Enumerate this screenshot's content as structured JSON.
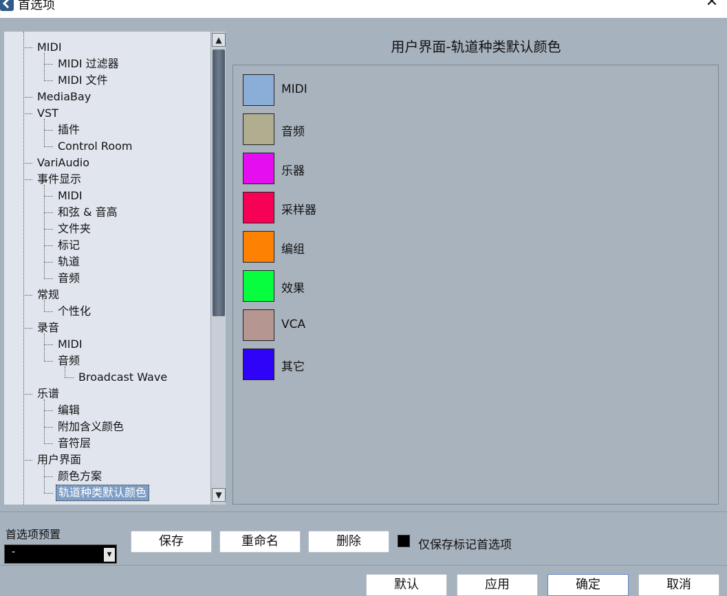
{
  "window": {
    "title": "首选项",
    "close_glyph": "✕",
    "icon": "app-icon"
  },
  "tree": {
    "items": [
      {
        "label": "MIDI",
        "level": 0
      },
      {
        "label": "MIDI 过滤器",
        "level": 1
      },
      {
        "label": "MIDI 文件",
        "level": 1
      },
      {
        "label": "MediaBay",
        "level": 0
      },
      {
        "label": "VST",
        "level": 0
      },
      {
        "label": "插件",
        "level": 1
      },
      {
        "label": "Control Room",
        "level": 1
      },
      {
        "label": "VariAudio",
        "level": 0
      },
      {
        "label": "事件显示",
        "level": 0
      },
      {
        "label": "MIDI",
        "level": 1
      },
      {
        "label": "和弦 & 音高",
        "level": 1
      },
      {
        "label": "文件夹",
        "level": 1
      },
      {
        "label": "标记",
        "level": 1
      },
      {
        "label": "轨道",
        "level": 1
      },
      {
        "label": "音频",
        "level": 1
      },
      {
        "label": "常规",
        "level": 0
      },
      {
        "label": "个性化",
        "level": 1
      },
      {
        "label": "录音",
        "level": 0
      },
      {
        "label": "MIDI",
        "level": 1
      },
      {
        "label": "音频",
        "level": 1
      },
      {
        "label": "Broadcast Wave",
        "level": 2
      },
      {
        "label": "乐谱",
        "level": 0
      },
      {
        "label": "编辑",
        "level": 1
      },
      {
        "label": "附加含义颜色",
        "level": 1
      },
      {
        "label": "音符层",
        "level": 1
      },
      {
        "label": "用户界面",
        "level": 0
      },
      {
        "label": "颜色方案",
        "level": 1
      },
      {
        "label": "轨道种类默认颜色",
        "level": 1,
        "selected": true
      }
    ]
  },
  "main": {
    "title": "用户界面-轨道种类默认颜色",
    "colors": [
      {
        "label": "MIDI",
        "color": "#8aaed8"
      },
      {
        "label": "音频",
        "color": "#b0ae8e"
      },
      {
        "label": "乐器",
        "color": "#e40ef0"
      },
      {
        "label": "采样器",
        "color": "#f50257"
      },
      {
        "label": "编组",
        "color": "#fd8204"
      },
      {
        "label": "效果",
        "color": "#07fe3e"
      },
      {
        "label": "VCA",
        "color": "#b59690"
      },
      {
        "label": "其它",
        "color": "#2e03f7"
      }
    ]
  },
  "presets": {
    "label": "首选项预置",
    "selected": "-",
    "buttons": {
      "save": "保存",
      "rename": "重命名",
      "delete": "删除"
    },
    "only_marked_label": "仅保存标记首选项"
  },
  "footer": {
    "default": "默认",
    "apply": "应用",
    "ok": "确定",
    "cancel": "取消"
  }
}
